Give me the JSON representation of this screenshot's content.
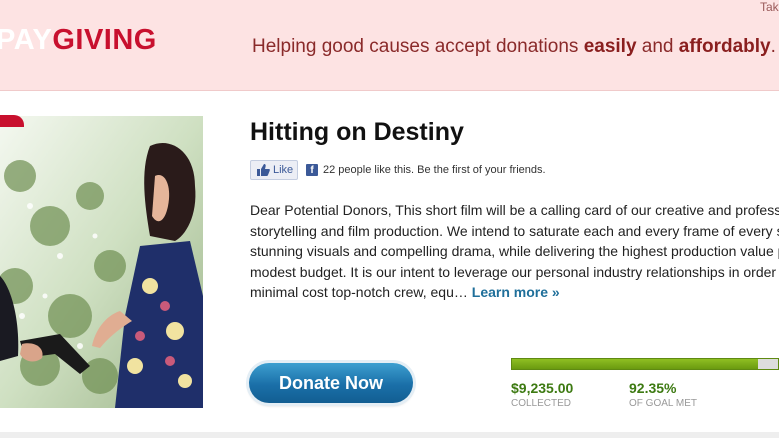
{
  "header": {
    "logo_pay": "PAY",
    "logo_giving": "GIVING",
    "tagline_parts": [
      "Helping good causes accept donations ",
      "easily",
      " and ",
      "affordably",
      "."
    ],
    "top_link": "Take"
  },
  "campaign": {
    "title": "Hitting on Destiny",
    "like_label": "Like",
    "like_text": "22 people like this. Be the first of your friends.",
    "description_lines": [
      "Dear Potential Donors, This short film will be a calling card of our creative and professio",
      "storytelling and film production. We intend to saturate each and every frame of every sce",
      "stunning visuals and compelling drama, while delivering the highest production value po",
      "modest budget. It is our intent to leverage our personal industry relationships in order to",
      "minimal cost top-notch crew, equ… "
    ],
    "learn_more": "Learn more »",
    "donate_label": "Donate Now",
    "collected_value": "$9,235.00",
    "collected_caption": "COLLECTED",
    "goal_value": "92.35%",
    "goal_caption": "OF GOAL MET",
    "progress_fraction": 0.9235
  },
  "colors": {
    "header_bg": "#fde3e3",
    "brand_red": "#c8102e",
    "donate_blue": "#1a6fa8",
    "progress_green": "#7aaa18",
    "stat_green": "#3d7a12",
    "link_blue": "#1f6f9a"
  },
  "icons": [
    "thumbs-up-icon",
    "facebook-icon"
  ]
}
